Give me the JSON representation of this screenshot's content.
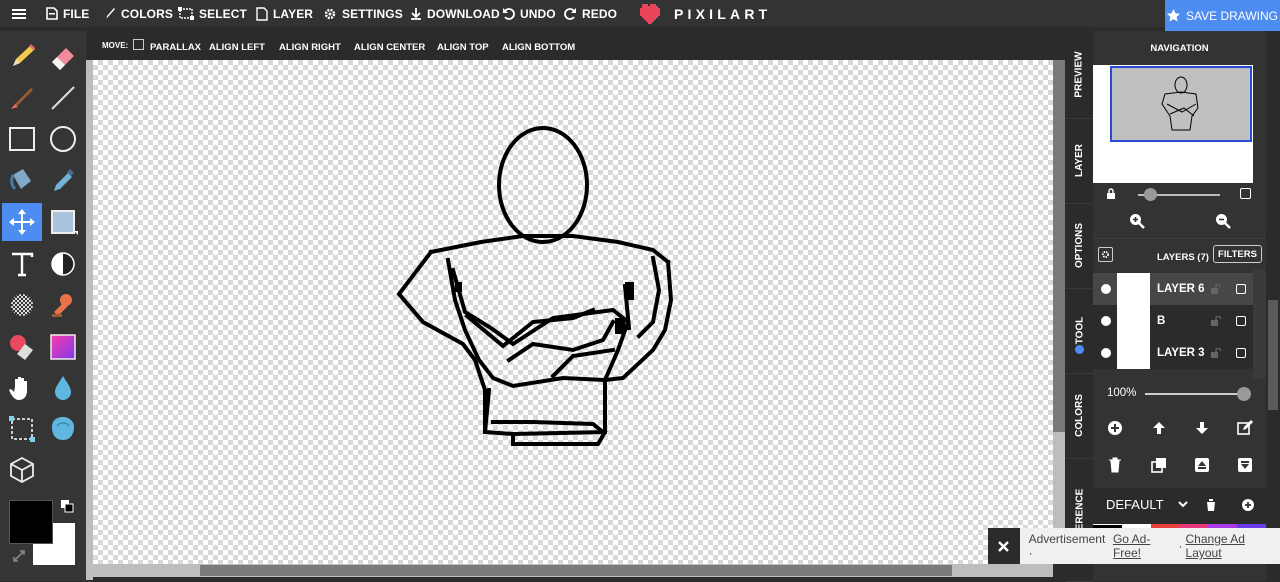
{
  "app": {
    "name": "PIXILART"
  },
  "menu": {
    "file": "FILE",
    "colors": "COLORS",
    "select": "SELECT",
    "layer": "LAYER",
    "settings": "SETTINGS",
    "download": "DOWNLOAD",
    "undo": "UNDO",
    "redo": "REDO"
  },
  "save_button": "SAVE DRAWING",
  "move_bar": {
    "label": "MOVE:",
    "parallax": "PARALLAX",
    "align_left": "ALIGN LEFT",
    "align_right": "ALIGN RIGHT",
    "align_center": "ALIGN CENTER",
    "align_top": "ALIGN TOP",
    "align_bottom": "ALIGN BOTTOM"
  },
  "side_tabs": [
    "PREVIEW",
    "LAYER",
    "OPTIONS",
    "TOOL",
    "COLORS",
    "REFERENCE"
  ],
  "navigation": {
    "title": "NAVIGATION"
  },
  "layers_panel": {
    "title": "LAYERS (7)",
    "filters": "FILTERS",
    "opacity": "100%"
  },
  "layers": [
    {
      "name": "LAYER 6"
    },
    {
      "name": "B"
    },
    {
      "name": "LAYER 3"
    }
  ],
  "palette": {
    "name": "DEFAULT"
  },
  "ad": {
    "text": "Advertisement · ",
    "go_ad_free": "Go Ad-Free!",
    "sep": " · ",
    "change_layout": "Change Ad Layout"
  },
  "colors": {
    "accent": "#4d8cf0",
    "primary": "#000000",
    "secondary": "#ffffff",
    "logo_heart": "#e8455a"
  }
}
